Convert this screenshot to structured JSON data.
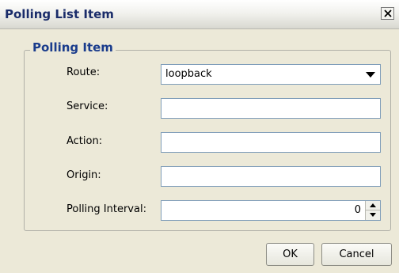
{
  "window": {
    "title": "Polling List Item",
    "close_glyph": "×"
  },
  "group": {
    "legend": "Polling Item"
  },
  "fields": {
    "route": {
      "label": "Route:",
      "value": "loopback"
    },
    "service": {
      "label": "Service:",
      "value": ""
    },
    "action": {
      "label": "Action:",
      "value": ""
    },
    "origin": {
      "label": "Origin:",
      "value": ""
    },
    "polling_interval": {
      "label": "Polling Interval:",
      "value": "0"
    }
  },
  "buttons": {
    "ok": "OK",
    "cancel": "Cancel"
  },
  "icons": {
    "close": "close-icon",
    "dropdown": "chevron-down-icon",
    "spin_up": "spin-up-icon",
    "spin_down": "spin-down-icon"
  },
  "colors": {
    "title_text": "#1a2c6a",
    "legend_text": "#1a3c8c",
    "dialog_bg": "#ece9d8",
    "field_border": "#7f9db9"
  }
}
